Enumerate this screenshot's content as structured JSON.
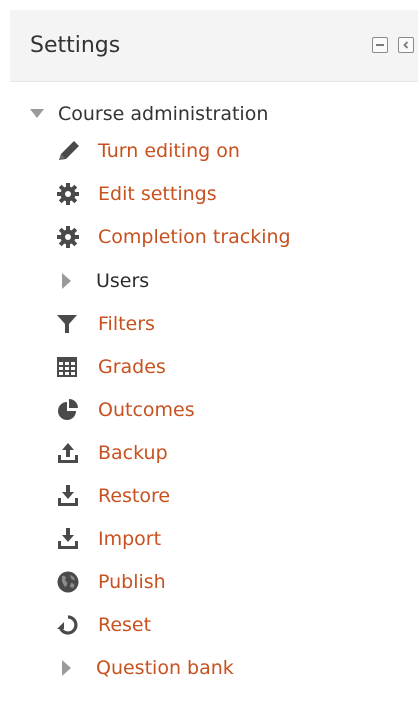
{
  "header": {
    "title": "Settings"
  },
  "tree": {
    "root_label": "Course administration",
    "items": [
      {
        "label": "Turn editing on",
        "icon": "pencil-icon",
        "kind": "link"
      },
      {
        "label": "Edit settings",
        "icon": "gear-icon",
        "kind": "link"
      },
      {
        "label": "Completion tracking",
        "icon": "gear-icon",
        "kind": "link"
      },
      {
        "label": "Users",
        "icon": "caret-right-icon",
        "kind": "branch"
      },
      {
        "label": "Filters",
        "icon": "filter-icon",
        "kind": "link"
      },
      {
        "label": "Grades",
        "icon": "table-icon",
        "kind": "link"
      },
      {
        "label": "Outcomes",
        "icon": "pie-chart-icon",
        "kind": "link"
      },
      {
        "label": "Backup",
        "icon": "upload-icon",
        "kind": "link"
      },
      {
        "label": "Restore",
        "icon": "download-icon",
        "kind": "link"
      },
      {
        "label": "Import",
        "icon": "download-icon",
        "kind": "link"
      },
      {
        "label": "Publish",
        "icon": "globe-icon",
        "kind": "link"
      },
      {
        "label": "Reset",
        "icon": "reset-icon",
        "kind": "link"
      },
      {
        "label": "Question bank",
        "icon": "caret-right-icon",
        "kind": "branch-link"
      }
    ]
  },
  "colors": {
    "link": "#c7511f",
    "text": "#2c2c2c",
    "icon": "#4a4a4a",
    "header_bg": "#f4f4f4"
  }
}
